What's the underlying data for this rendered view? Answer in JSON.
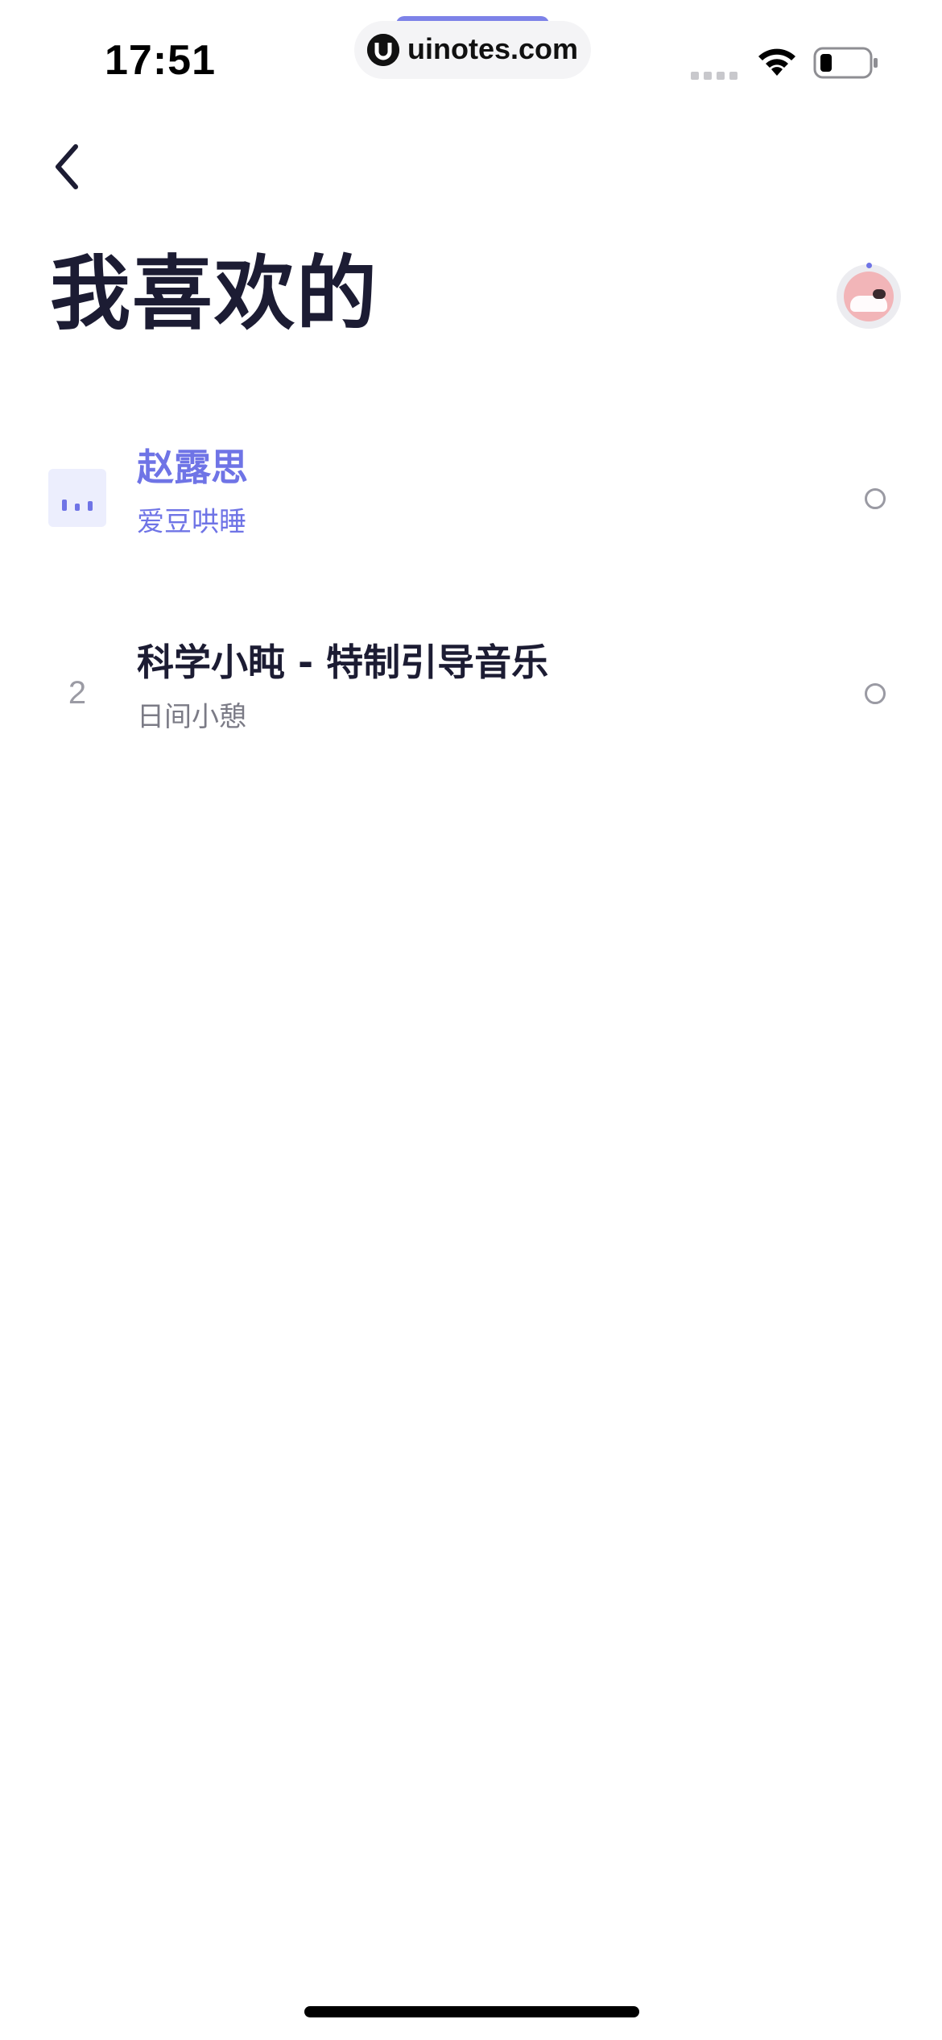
{
  "status_bar": {
    "time": "17:51",
    "url": "uinotes.com",
    "icons": [
      "cellular-signal-icon",
      "wifi-icon",
      "battery-icon"
    ]
  },
  "nav": {
    "back_icon": "chevron-left-icon"
  },
  "page": {
    "title": "我喜欢的"
  },
  "now_playing": {
    "icon": "avatar-thumbnail"
  },
  "tracks": [
    {
      "index_display": "",
      "indicator_icon": "equalizer-icon",
      "playing": true,
      "title": "赵露思",
      "subtitle": "爱豆哄睡"
    },
    {
      "index_display": "2",
      "playing": false,
      "title": "科学小盹 - 特制引导音乐",
      "subtitle": "日间小憩"
    }
  ],
  "colors": {
    "accent": "#6f74e6",
    "title": "#1c1c33",
    "secondary": "#7b7b86",
    "indicator_bg": "#eceefd"
  }
}
